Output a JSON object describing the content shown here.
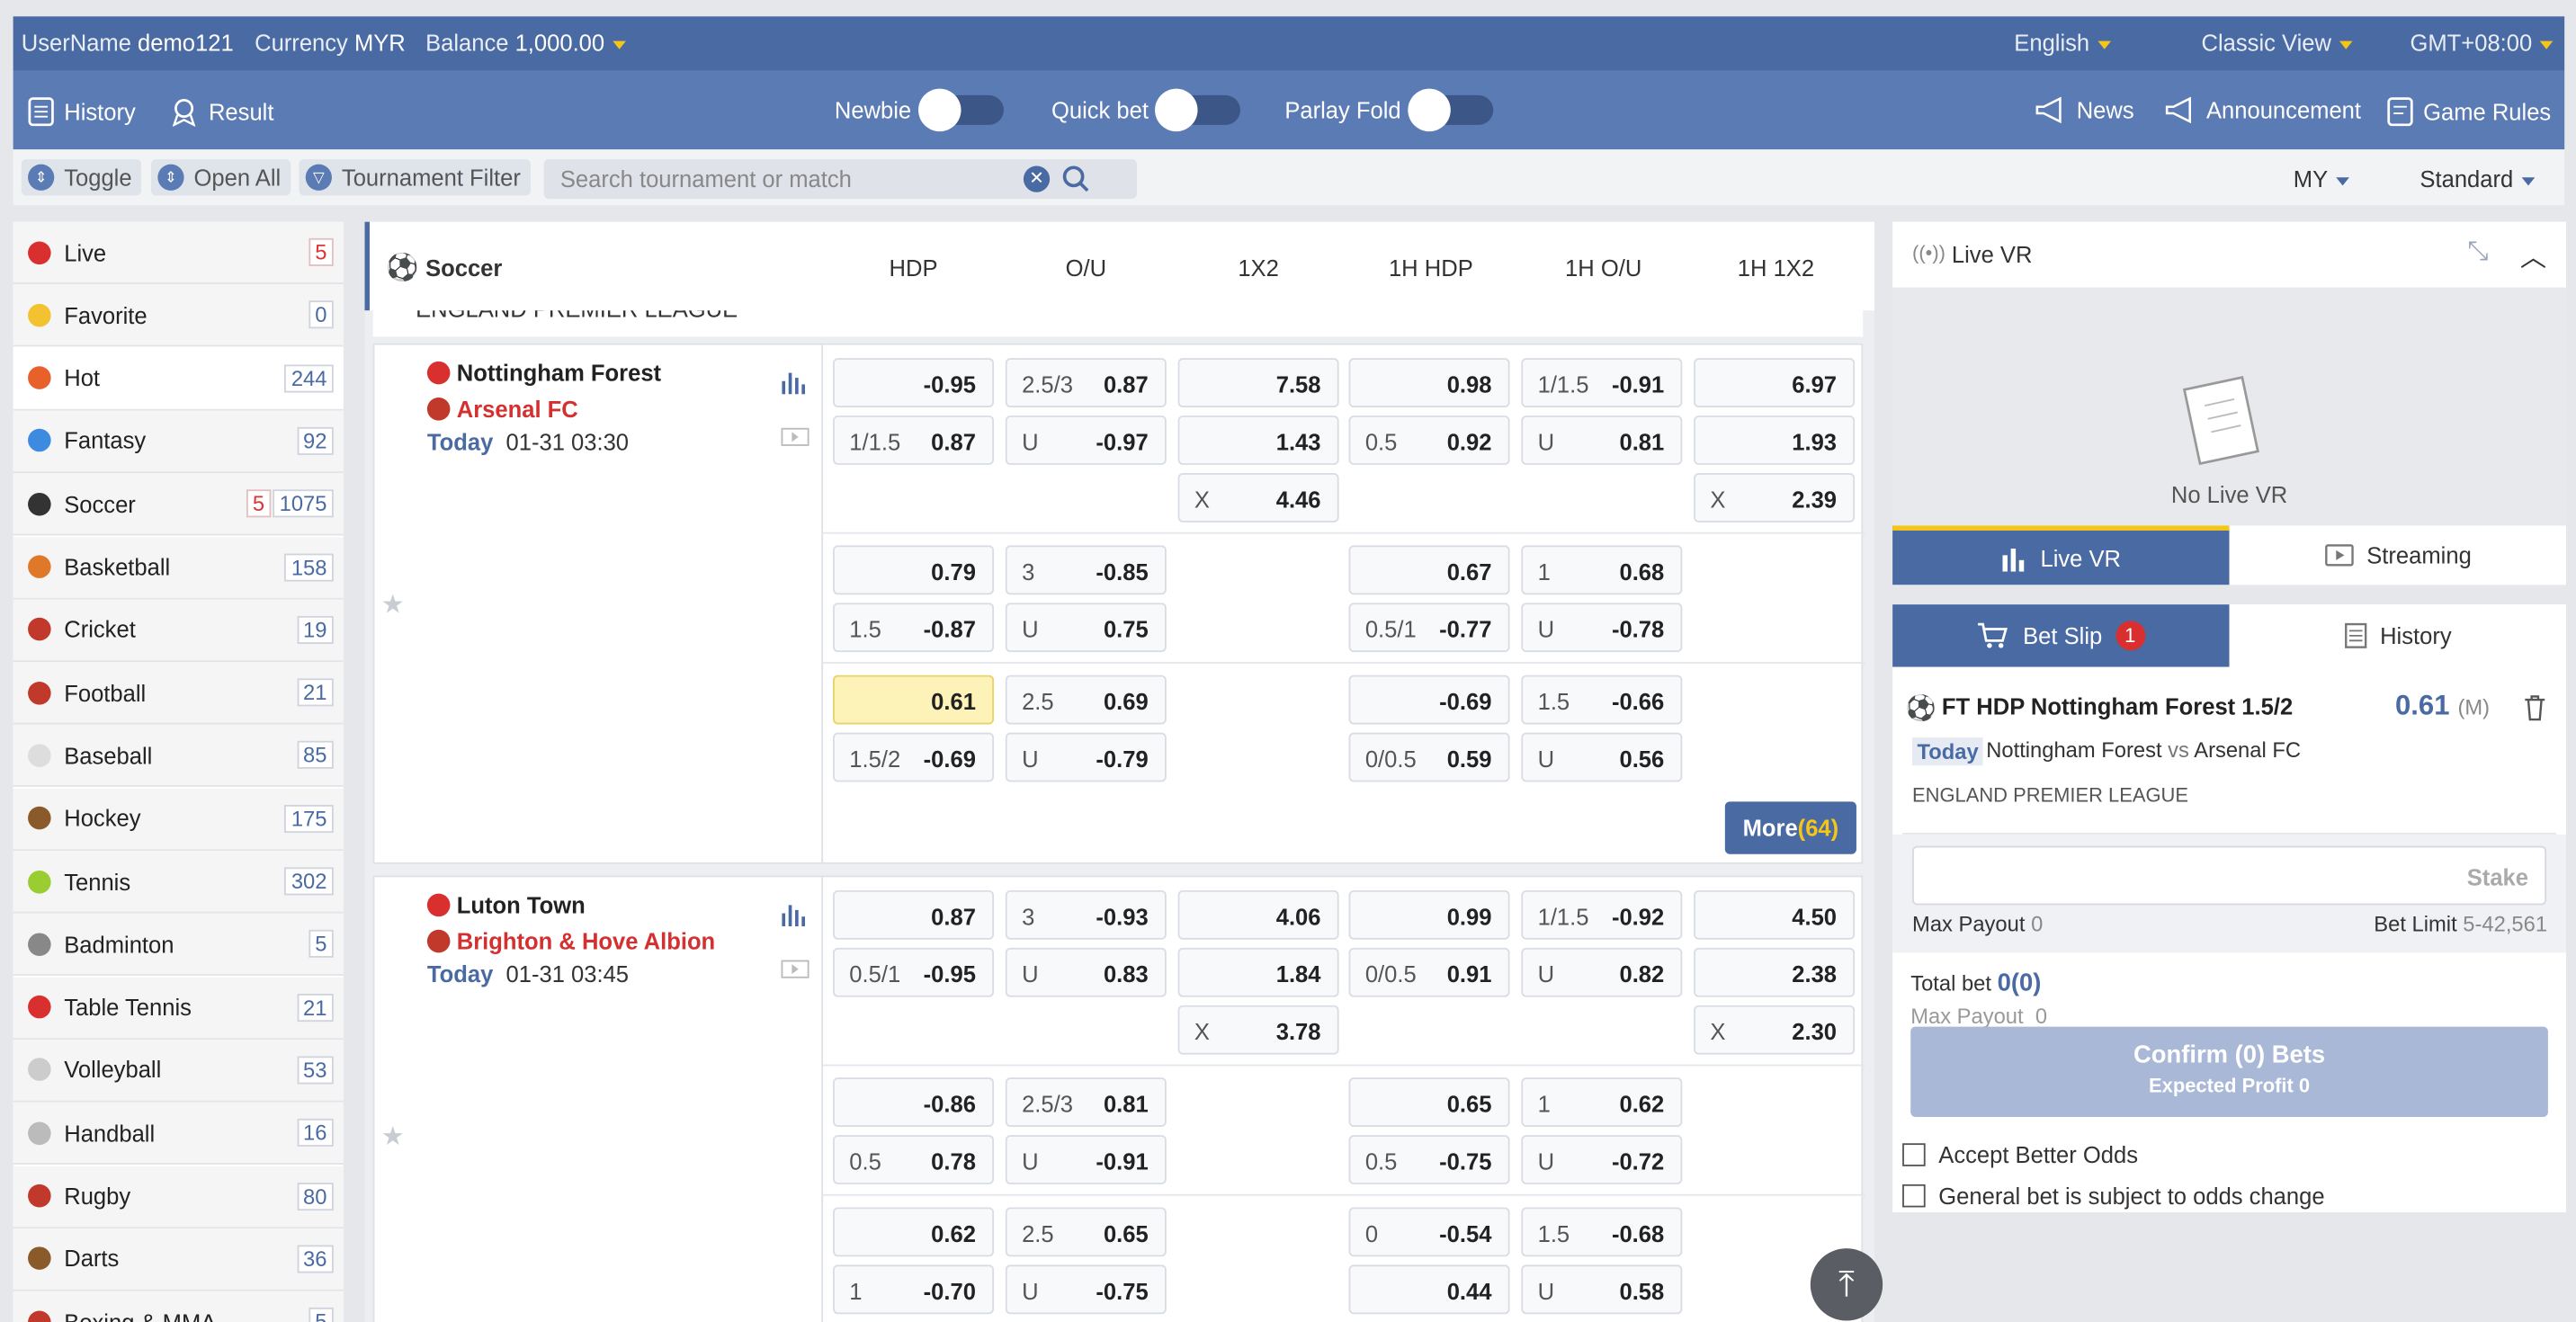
{
  "topbar": {
    "username_label": "UserName",
    "username": "demo121",
    "currency_label": "Currency",
    "currency": "MYR",
    "balance_label": "Balance",
    "balance": "1,000.00",
    "language": "English",
    "view": "Classic View",
    "timezone": "GMT+08:00"
  },
  "navbar": {
    "history": "History",
    "result": "Result",
    "newbie": "Newbie",
    "quick_bet": "Quick bet",
    "parlay_fold": "Parlay Fold",
    "news": "News",
    "announcement": "Announcement",
    "game_rules": "Game Rules"
  },
  "filterbar": {
    "toggle": "Toggle",
    "open_all": "Open All",
    "tournament_filter": "Tournament Filter",
    "search_placeholder": "Search tournament or match",
    "odds_type": "MY",
    "display": "Standard"
  },
  "sidebar": {
    "items": [
      {
        "label": "Live",
        "count": "5",
        "live": "",
        "color": "#d9302f"
      },
      {
        "label": "Favorite",
        "count": "0",
        "live": "",
        "color": "#f2c230"
      },
      {
        "label": "Hot",
        "count": "244",
        "live": "",
        "color": "#e8602a"
      },
      {
        "label": "Fantasy",
        "count": "92",
        "live": "",
        "color": "#3d8be0"
      },
      {
        "label": "Soccer",
        "count": "1075",
        "live": "5",
        "color": "#333333"
      },
      {
        "label": "Basketball",
        "count": "158",
        "live": "",
        "color": "#e0782a"
      },
      {
        "label": "Cricket",
        "count": "19",
        "live": "",
        "color": "#c0392b"
      },
      {
        "label": "Football",
        "count": "21",
        "live": "",
        "color": "#c0392b"
      },
      {
        "label": "Baseball",
        "count": "85",
        "live": "",
        "color": "#dddddd"
      },
      {
        "label": "Hockey",
        "count": "175",
        "live": "",
        "color": "#8a5a2b"
      },
      {
        "label": "Tennis",
        "count": "302",
        "live": "",
        "color": "#9acd32"
      },
      {
        "label": "Badminton",
        "count": "5",
        "live": "",
        "color": "#888888"
      },
      {
        "label": "Table Tennis",
        "count": "21",
        "live": "",
        "color": "#d9302f"
      },
      {
        "label": "Volleyball",
        "count": "53",
        "live": "",
        "color": "#cccccc"
      },
      {
        "label": "Handball",
        "count": "16",
        "live": "",
        "color": "#bbbbbb"
      },
      {
        "label": "Rugby",
        "count": "80",
        "live": "",
        "color": "#c0392b"
      },
      {
        "label": "Darts",
        "count": "36",
        "live": "",
        "color": "#8a5a2b"
      },
      {
        "label": "Boxing & MMA",
        "count": "5",
        "live": "",
        "color": "#c0392b"
      }
    ]
  },
  "main": {
    "sport": "Soccer",
    "columns": [
      "HDP",
      "O/U",
      "1X2",
      "1H HDP",
      "1H O/U",
      "1H 1X2"
    ],
    "league": "ENGLAND PREMIER LEAGUE",
    "more_label": "More",
    "more_count": "(64)",
    "matches": [
      {
        "home": "Nottingham Forest",
        "away": "Arsenal FC",
        "day": "Today",
        "time": "01-31 03:30",
        "rows": [
          [
            "",
            "-0.95",
            "2.5/3",
            "0.87",
            "",
            "7.58",
            "",
            "0.98",
            "1/1.5",
            "-0.91",
            "",
            "6.97"
          ],
          [
            "1/1.5",
            "0.87",
            "U",
            "-0.97",
            "",
            "1.43",
            "0.5",
            "0.92",
            "U",
            "0.81",
            "",
            "1.93"
          ],
          [
            "",
            "",
            "",
            "",
            "X",
            "4.46",
            "",
            "",
            "",
            "",
            "X",
            "2.39"
          ],
          [
            "",
            "0.79",
            "3",
            "-0.85",
            "",
            "",
            "",
            "0.67",
            "1",
            "0.68",
            "",
            ""
          ],
          [
            "1.5",
            "-0.87",
            "U",
            "0.75",
            "",
            "",
            "0.5/1",
            "-0.77",
            "U",
            "-0.78",
            "",
            ""
          ],
          [
            "",
            "0.61",
            "2.5",
            "0.69",
            "",
            "",
            "",
            "-0.69",
            "1.5",
            "-0.66",
            "",
            ""
          ],
          [
            "1.5/2",
            "-0.69",
            "U",
            "-0.79",
            "",
            "",
            "0/0.5",
            "0.59",
            "U",
            "0.56",
            "",
            ""
          ]
        ]
      },
      {
        "home": "Luton Town",
        "away": "Brighton & Hove Albion",
        "day": "Today",
        "time": "01-31 03:45",
        "rows": [
          [
            "",
            "0.87",
            "3",
            "-0.93",
            "",
            "4.06",
            "",
            "0.99",
            "1/1.5",
            "-0.92",
            "",
            "4.50"
          ],
          [
            "0.5/1",
            "-0.95",
            "U",
            "0.83",
            "",
            "1.84",
            "0/0.5",
            "0.91",
            "U",
            "0.82",
            "",
            "2.38"
          ],
          [
            "",
            "",
            "",
            "",
            "X",
            "3.78",
            "",
            "",
            "",
            "",
            "X",
            "2.30"
          ],
          [
            "",
            "-0.86",
            "2.5/3",
            "0.81",
            "",
            "",
            "",
            "0.65",
            "1",
            "0.62",
            "",
            ""
          ],
          [
            "0.5",
            "0.78",
            "U",
            "-0.91",
            "",
            "",
            "0.5",
            "-0.75",
            "U",
            "-0.72",
            "",
            ""
          ],
          [
            "",
            "0.62",
            "2.5",
            "0.65",
            "",
            "",
            "0",
            "-0.54",
            "1.5",
            "-0.68",
            "",
            ""
          ],
          [
            "1",
            "-0.70",
            "U",
            "-0.75",
            "",
            "",
            "",
            "0.44",
            "U",
            "0.58",
            "",
            ""
          ]
        ]
      }
    ]
  },
  "livevr": {
    "title": "Live VR",
    "empty": "No Live VR",
    "tab_live": "Live VR",
    "tab_streaming": "Streaming"
  },
  "betslip": {
    "tab_slip": "Bet Slip",
    "slip_count": "1",
    "tab_history": "History",
    "selection": "FT HDP Nottingham Forest 1.5/2",
    "odds": "0.61",
    "odds_type": "(M)",
    "day": "Today",
    "home": "Nottingham Forest",
    "vs": "vs",
    "away": "Arsenal FC",
    "league": "ENGLAND PREMIER LEAGUE",
    "stake_placeholder": "Stake",
    "max_payout_label": "Max Payout",
    "max_payout": "0",
    "bet_limit_label": "Bet Limit",
    "bet_limit": "5-42,561",
    "total_bet_label": "Total bet",
    "total_bet": "0(0)",
    "max_payout2_label": "Max Payout",
    "max_payout2": "0",
    "confirm": "Confirm (0) Bets",
    "expected": "Expected Profit 0",
    "accept_better": "Accept Better Odds",
    "subject_change": "General bet is subject to odds change"
  }
}
